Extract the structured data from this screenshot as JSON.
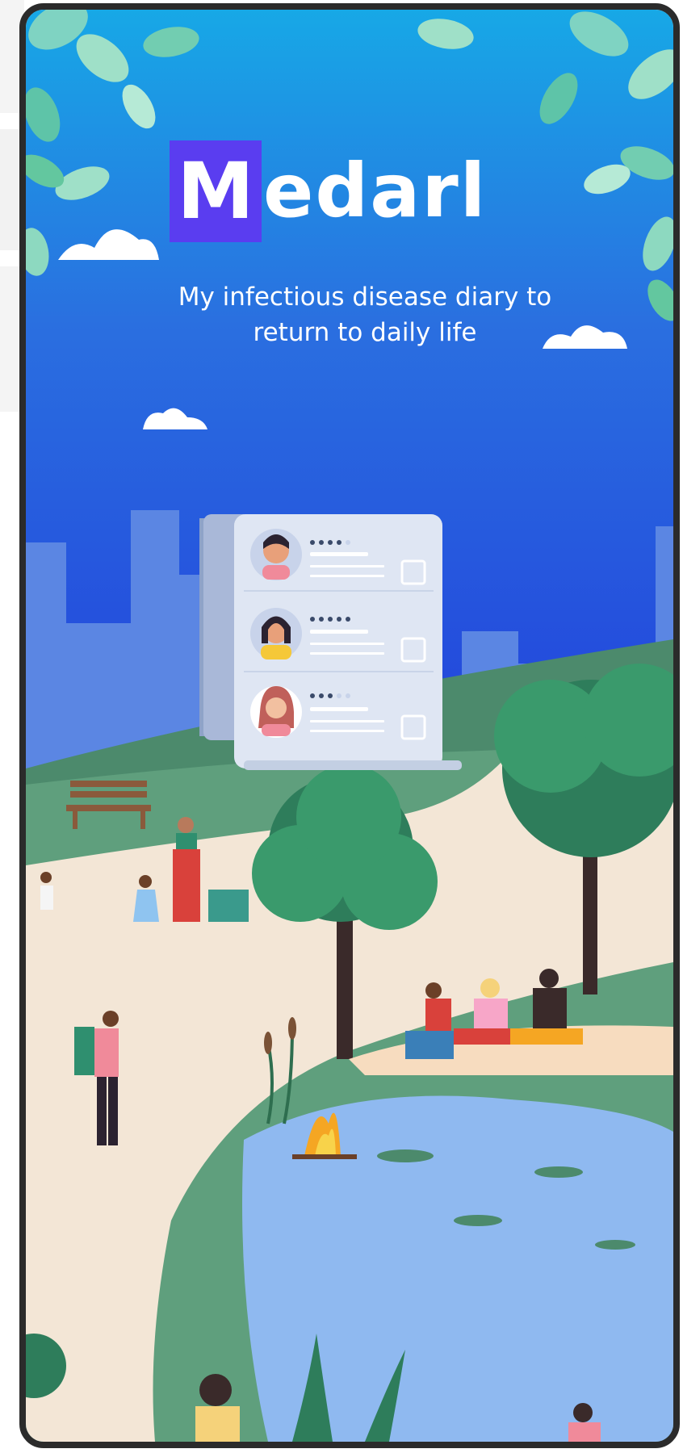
{
  "app": {
    "logo_first": "M",
    "logo_rest": "edarl",
    "tagline": "My infectious disease diary to return to daily life"
  },
  "cards": [
    {
      "rating": 4,
      "max": 5
    },
    {
      "rating": 5,
      "max": 5
    },
    {
      "rating": 3,
      "max": 5
    }
  ],
  "colors": {
    "sky_top": "#17a8e6",
    "sky_bottom": "#2347dc",
    "logo_accent": "#5a3df0",
    "frame": "#2b2b2b"
  }
}
